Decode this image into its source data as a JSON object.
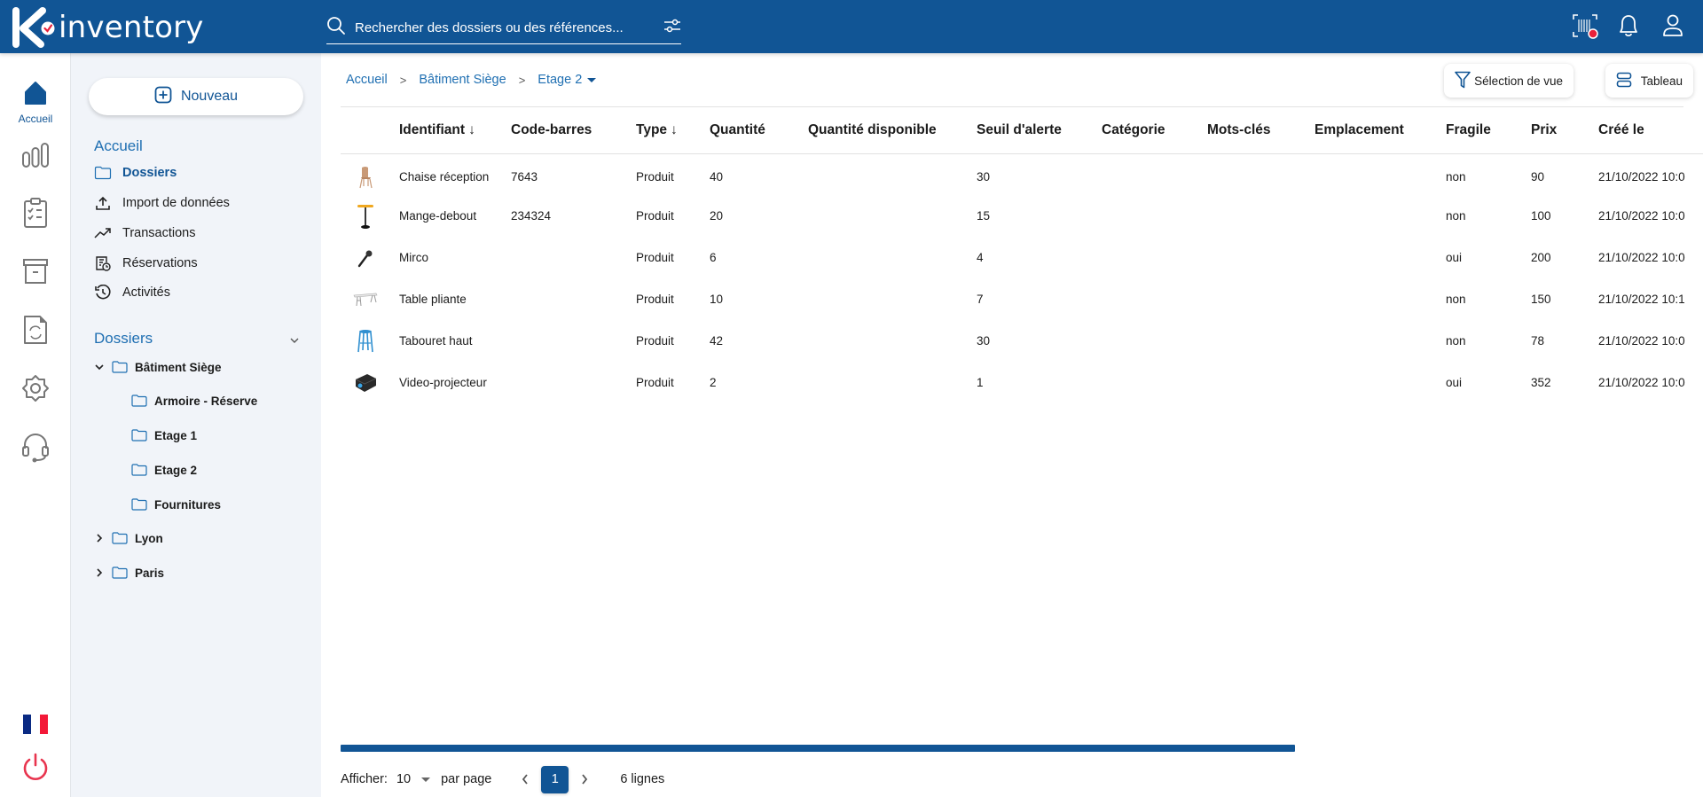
{
  "app": {
    "name": "inventory",
    "brand_color": "#115595"
  },
  "topbar": {
    "search_placeholder": "Rechercher des dossiers ou des références...",
    "icons": [
      "barcode-scanner-icon",
      "bell-icon",
      "user-icon"
    ],
    "scanner_badge_color": "#e8203a"
  },
  "rail": {
    "items": [
      {
        "icon": "home-icon",
        "label": "Accueil",
        "active": true
      },
      {
        "icon": "bar-chart-icon",
        "label": ""
      },
      {
        "icon": "clipboard-check-icon",
        "label": ""
      },
      {
        "icon": "archive-box-icon",
        "label": ""
      },
      {
        "icon": "file-sync-icon",
        "label": ""
      },
      {
        "icon": "gear-icon",
        "label": ""
      },
      {
        "icon": "headset-icon",
        "label": ""
      }
    ],
    "bottom": [
      {
        "icon": "french-flag-icon"
      },
      {
        "icon": "power-icon",
        "color": "#e8344e"
      }
    ]
  },
  "sidebar": {
    "new_button": "Nouveau",
    "home_section": "Accueil",
    "nav": [
      {
        "label": "Dossiers",
        "icon": "folder-icon",
        "active": true
      },
      {
        "label": "Import de données",
        "icon": "upload-icon"
      },
      {
        "label": "Transactions",
        "icon": "trending-up-icon"
      },
      {
        "label": "Réservations",
        "icon": "reservation-icon"
      },
      {
        "label": "Activités",
        "icon": "history-icon"
      }
    ],
    "folders_section": "Dossiers",
    "tree": [
      {
        "label": "Bâtiment Siège",
        "expanded": true,
        "level": 0
      },
      {
        "label": "Armoire - Réserve",
        "level": 1
      },
      {
        "label": "Etage 1",
        "level": 1
      },
      {
        "label": "Etage 2",
        "level": 1
      },
      {
        "label": "Fournitures",
        "level": 1
      },
      {
        "label": "Lyon",
        "expanded": false,
        "level": 0
      },
      {
        "label": "Paris",
        "expanded": false,
        "level": 0
      }
    ]
  },
  "main": {
    "breadcrumb": [
      "Accueil",
      "Bâtiment Siège",
      "Etage 2"
    ],
    "view_selection_button": "Sélection de vue",
    "table_view_button": "Tableau",
    "columns": [
      {
        "label": "",
        "key": "image"
      },
      {
        "label": "Identifiant",
        "sort": "desc"
      },
      {
        "label": "Code-barres"
      },
      {
        "label": "Type",
        "sort": "desc"
      },
      {
        "label": "Quantité"
      },
      {
        "label": "Quantité disponible"
      },
      {
        "label": "Seuil d'alerte"
      },
      {
        "label": "Catégorie"
      },
      {
        "label": "Mots-clés"
      },
      {
        "label": "Emplacement"
      },
      {
        "label": "Fragile"
      },
      {
        "label": "Prix"
      },
      {
        "label": "Créé le"
      }
    ],
    "rows": [
      {
        "image": "chair-image",
        "id": "Chaise réception",
        "barcode": "7643",
        "type": "Produit",
        "qty": "40",
        "qty_avail": "",
        "alert": "30",
        "category": "",
        "keywords": "",
        "location": "",
        "fragile": "non",
        "price": "90",
        "created": "21/10/2022 10:0"
      },
      {
        "image": "standing-table-image",
        "id": "Mange-debout",
        "barcode": "234324",
        "type": "Produit",
        "qty": "20",
        "qty_avail": "",
        "alert": "15",
        "category": "",
        "keywords": "",
        "location": "",
        "fragile": "non",
        "price": "100",
        "created": "21/10/2022 10:0"
      },
      {
        "image": "microphone-image",
        "id": "Mirco",
        "barcode": "",
        "type": "Produit",
        "qty": "6",
        "qty_avail": "",
        "alert": "4",
        "category": "",
        "keywords": "",
        "location": "",
        "fragile": "oui",
        "price": "200",
        "created": "21/10/2022 10:0"
      },
      {
        "image": "folding-table-image",
        "id": "Table pliante",
        "barcode": "",
        "type": "Produit",
        "qty": "10",
        "qty_avail": "",
        "alert": "7",
        "category": "",
        "keywords": "",
        "location": "",
        "fragile": "non",
        "price": "150",
        "created": "21/10/2022 10:1"
      },
      {
        "image": "stool-image",
        "id": "Tabouret haut",
        "barcode": "",
        "type": "Produit",
        "qty": "42",
        "qty_avail": "",
        "alert": "30",
        "category": "",
        "keywords": "",
        "location": "",
        "fragile": "non",
        "price": "78",
        "created": "21/10/2022 10:0"
      },
      {
        "image": "projector-image",
        "id": "Video-projecteur",
        "barcode": "",
        "type": "Produit",
        "qty": "2",
        "qty_avail": "",
        "alert": "1",
        "category": "",
        "keywords": "",
        "location": "",
        "fragile": "oui",
        "price": "352",
        "created": "21/10/2022 10:0"
      }
    ],
    "pagination": {
      "show_label": "Afficher:",
      "per_page_value": "10",
      "per_page_label": "par page",
      "current_page": "1",
      "total_label": "6 lignes"
    }
  }
}
